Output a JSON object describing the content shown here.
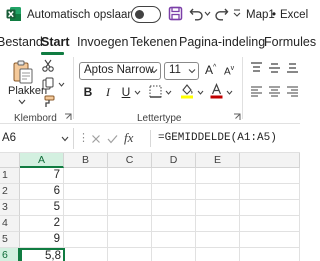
{
  "titlebar": {
    "autosave_label": "Automatisch opslaan",
    "doc_title": "Map1",
    "separator": "•",
    "app_name": "Excel"
  },
  "tabs": [
    {
      "label": "Bestand",
      "active": false
    },
    {
      "label": "Start",
      "active": true
    },
    {
      "label": "Invoegen",
      "active": false
    },
    {
      "label": "Tekenen",
      "active": false
    },
    {
      "label": "Pagina-indeling",
      "active": false
    },
    {
      "label": "Formules",
      "active": false
    }
  ],
  "ribbon": {
    "paste_label": "Plakken",
    "clipboard_group": "Klembord",
    "font_group": "Lettertype",
    "font_name": "Aptos Narrow",
    "font_size": "11",
    "bold": "B",
    "italic": "I",
    "underline": "U"
  },
  "formula_bar": {
    "name_box": "A6",
    "dots": "⋮",
    "fx": "fx",
    "formula": "=GEMIDDELDE(A1:A5)"
  },
  "grid": {
    "columns": [
      "A",
      "B",
      "C",
      "D",
      "E"
    ],
    "rows": [
      "1",
      "2",
      "3",
      "4",
      "5",
      "6"
    ],
    "column_a_values": [
      "7",
      "6",
      "5",
      "2",
      "9",
      "5,8"
    ],
    "selected_cell": "A6"
  },
  "colors": {
    "accent": "#107c41",
    "font_color_red": "#c00000",
    "highlight_yellow": "#ffff00"
  }
}
